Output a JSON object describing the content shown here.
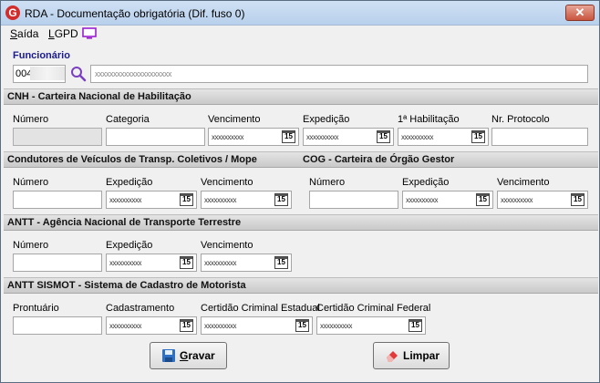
{
  "window": {
    "title": "RDA - Documentação obrigatória (Dif. fuso 0)",
    "logo_letter": "G",
    "close_glyph": "✕"
  },
  "menu": {
    "saida_first": "S",
    "saida_rest": "aída",
    "lgpd_first": "L",
    "lgpd_rest": "GPD",
    "icon": "monitor-icon"
  },
  "funcionario": {
    "label": "Funcionário",
    "code": "004",
    "name": "xxxxxxxxxxxxxxxxxxxxx"
  },
  "date_mask": "xxxxxxxxxx",
  "cal_label": "15",
  "cnh": {
    "title": "CNH - Carteira Nacional de Habilitação",
    "numero": "Número",
    "categoria": "Categoria",
    "vencimento": "Vencimento",
    "expedicao": "Expedição",
    "primeira_habilitacao": "1ª Habilitação",
    "nr_protocolo": "Nr. Protocolo"
  },
  "condutores": {
    "title": "Condutores de Veículos de Transp. Coletivos / Mope",
    "numero": "Número",
    "expedicao": "Expedição",
    "vencimento": "Vencimento"
  },
  "cog": {
    "title": "COG - Carteira de Órgão Gestor",
    "numero": "Número",
    "expedicao": "Expedição",
    "vencimento": "Vencimento"
  },
  "antt": {
    "title": "ANTT - Agência Nacional de Transporte Terrestre",
    "numero": "Número",
    "expedicao": "Expedição",
    "vencimento": "Vencimento"
  },
  "sismot": {
    "title": "ANTT SISMOT - Sistema de Cadastro de Motorista",
    "prontuario": "Prontuário",
    "cadastramento": "Cadastramento",
    "certidao_estadual": "Certidão Criminal Estadual",
    "certidao_federal": "Certidão Criminal Federal"
  },
  "buttons": {
    "gravar_first": "G",
    "gravar_rest": "ravar",
    "limpar": "Limpar"
  },
  "colors": {
    "section_title": "#111111",
    "funcionario_label": "#1b1b8c",
    "close_button": "#c8553f"
  }
}
